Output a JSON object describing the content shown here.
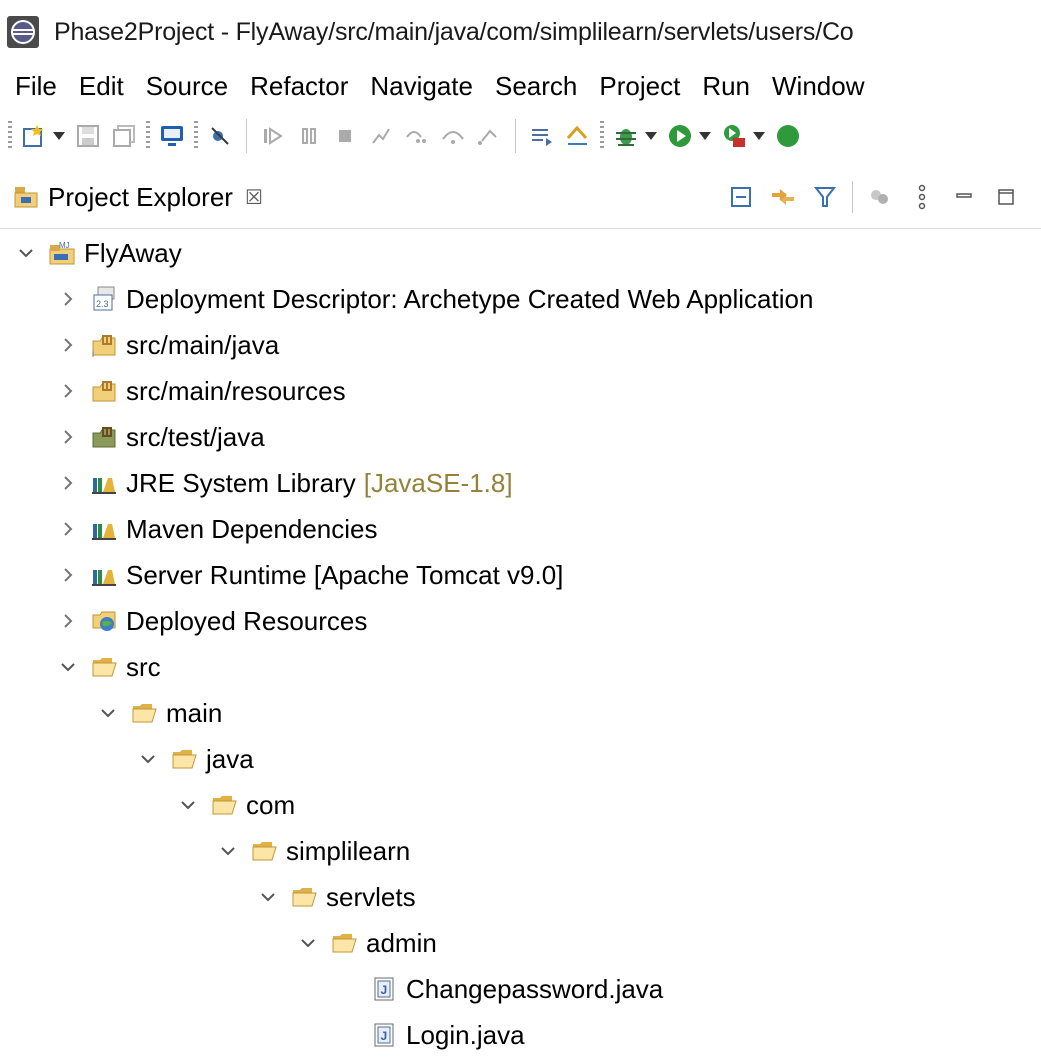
{
  "window": {
    "title": "Phase2Project - FlyAway/src/main/java/com/simplilearn/servlets/users/Co"
  },
  "menu": [
    "File",
    "Edit",
    "Source",
    "Refactor",
    "Navigate",
    "Search",
    "Project",
    "Run",
    "Window"
  ],
  "toolbar": {
    "icons": [
      "new-wizard-icon",
      "save-icon",
      "save-all-icon",
      "terminal-icon",
      "skip-breakpoints-icon",
      "resume-icon",
      "suspend-icon",
      "terminate-icon",
      "disconnect-icon",
      "step-into-icon",
      "step-over-icon",
      "step-return-icon",
      "drop-to-frame-icon",
      "use-step-filters-icon",
      "debug-icon",
      "run-icon",
      "external-tools-icon"
    ]
  },
  "explorer": {
    "tab_label": "Project Explorer",
    "close_glyph": "☒"
  },
  "tree": [
    {
      "label": "FlyAway",
      "expanded": true,
      "icon": "project-icon"
    },
    {
      "label": "Deployment Descriptor: Archetype Created Web Application",
      "expanded": false,
      "icon": "deployment-descriptor-icon"
    },
    {
      "label": "src/main/java",
      "expanded": false,
      "icon": "source-folder-icon"
    },
    {
      "label": "src/main/resources",
      "expanded": false,
      "icon": "source-folder-icon"
    },
    {
      "label": "src/test/java",
      "expanded": false,
      "icon": "test-source-folder-icon"
    },
    {
      "label": "JRE System Library",
      "decoration": "[JavaSE-1.8]",
      "expanded": false,
      "icon": "library-icon"
    },
    {
      "label": "Maven Dependencies",
      "expanded": false,
      "icon": "library-icon"
    },
    {
      "label": "Server Runtime [Apache Tomcat v9.0]",
      "expanded": false,
      "icon": "library-icon"
    },
    {
      "label": "Deployed Resources",
      "expanded": false,
      "icon": "deployed-resources-icon"
    },
    {
      "label": "src",
      "expanded": true,
      "icon": "folder-open-icon"
    },
    {
      "label": "main",
      "expanded": true,
      "icon": "folder-open-icon"
    },
    {
      "label": "java",
      "expanded": true,
      "icon": "folder-open-icon"
    },
    {
      "label": "com",
      "expanded": true,
      "icon": "folder-open-icon"
    },
    {
      "label": "simplilearn",
      "expanded": true,
      "icon": "folder-open-icon"
    },
    {
      "label": "servlets",
      "expanded": true,
      "icon": "folder-open-icon"
    },
    {
      "label": "admin",
      "expanded": true,
      "icon": "folder-open-icon"
    },
    {
      "label": "Changepassword.java",
      "icon": "java-file-icon"
    },
    {
      "label": "Login.java",
      "icon": "java-file-icon"
    }
  ]
}
